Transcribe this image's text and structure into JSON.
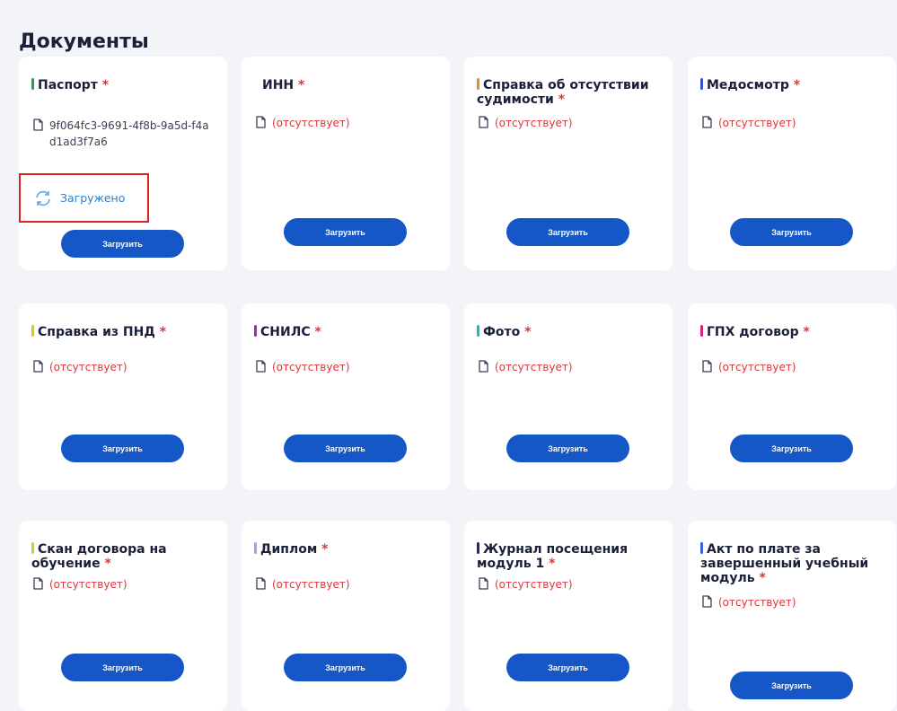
{
  "page": {
    "title": "Документы"
  },
  "colors": {
    "missing": "#e0343a",
    "button": "#1557c7",
    "status": "#2f80d0",
    "highlight": "#e01f1f"
  },
  "upload_label": "Загрузить",
  "missing_label": "(отсутствует)",
  "required_mark": "*",
  "status_icon": "refresh-icon",
  "file_icon": "document-icon",
  "cards": [
    {
      "title": "Паспорт",
      "color": "#1fa64a",
      "file": "9f064fc3-9691-4f8b-9a5d-f4ad1ad3f7a6",
      "status": "Загружено"
    },
    {
      "title": "ИНН",
      "color": "",
      "file": ""
    },
    {
      "title": "Справка об отсутствии судимости",
      "color": "#f08a24",
      "file": ""
    },
    {
      "title": "Медосмотр",
      "color": "#3a4fd6",
      "file": ""
    },
    {
      "title": "Справка из ПНД",
      "color": "#e2c51c",
      "file": ""
    },
    {
      "title": "СНИЛС",
      "color": "#b020c8",
      "file": ""
    },
    {
      "title": "Фото",
      "color": "#22b5c8",
      "file": ""
    },
    {
      "title": "ГПХ договор",
      "color": "#d62478",
      "file": ""
    },
    {
      "title": "Скан договора на обучение",
      "color": "#b8d830",
      "file": ""
    },
    {
      "title": "Диплом",
      "color": "#9aa4ee",
      "file": ""
    },
    {
      "title": "Журнал посещения модуль 1",
      "color": "#23257a",
      "file": ""
    },
    {
      "title": "Акт по плате за завершенный учебный модуль",
      "color": "#3a5fd6",
      "file": ""
    }
  ]
}
